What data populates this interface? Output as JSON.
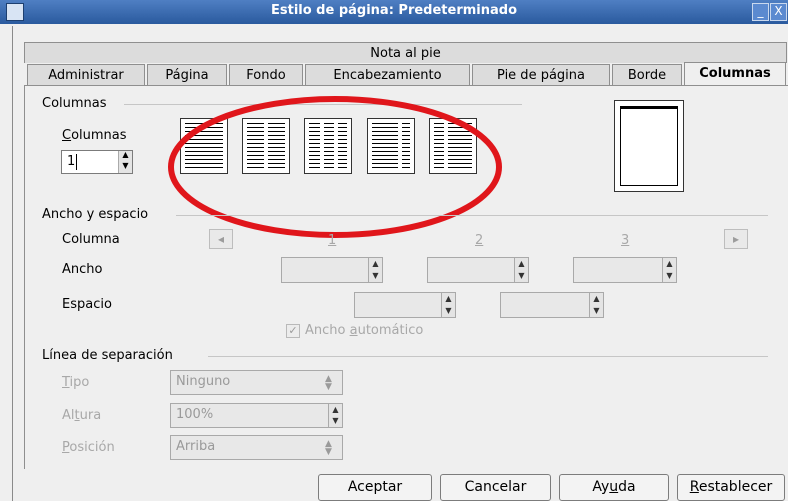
{
  "window": {
    "title": "Estilo de página: Predeterminado",
    "minimize_glyph": "_",
    "close_glyph": "X"
  },
  "tabs_top": [
    {
      "label": "Nota al pie"
    }
  ],
  "tabs": [
    {
      "label": "Administrar"
    },
    {
      "label": "Página"
    },
    {
      "label": "Fondo"
    },
    {
      "label": "Encabezamiento"
    },
    {
      "label": "Pie de página"
    },
    {
      "label": "Borde"
    },
    {
      "label": "Columnas",
      "active": true
    }
  ],
  "columnas": {
    "section_title": "Columnas",
    "field_label_mnemonic": "C",
    "field_label_rest": "olumnas",
    "value": "1",
    "presets": [
      "1 columna",
      "2 columnas",
      "3 columnas",
      "2 columnas izquierda",
      "2 columnas derecha"
    ]
  },
  "ancho_espacio": {
    "section_title": "Ancho y espacio",
    "columna_label": "Columna",
    "ancho_label": "Ancho",
    "espacio_label": "Espacio",
    "col_numbers": [
      "1",
      "2",
      "3"
    ],
    "auto_width_pre": "Ancho ",
    "auto_width_mnemonic": "a",
    "auto_width_rest": "utomático",
    "auto_width_checked": true
  },
  "separacion": {
    "section_title": "Línea de separación",
    "tipo_mnemonic": "T",
    "tipo_rest": "ipo",
    "tipo_value": "Ninguno",
    "altura_pre": "Al",
    "altura_mnemonic": "t",
    "altura_rest": "ura",
    "altura_value": "100%",
    "posicion_mnemonic": "P",
    "posicion_rest": "osición",
    "posicion_value": "Arriba"
  },
  "buttons": {
    "aceptar": "Aceptar",
    "cancelar": "Cancelar",
    "ayuda_pre": "Ay",
    "ayuda_mnemonic": "u",
    "ayuda_rest": "da",
    "restablecer_mnemonic": "R",
    "restablecer_rest": "establecer"
  },
  "annotation": {
    "color": "#e0161b",
    "shape": "ellipse"
  }
}
